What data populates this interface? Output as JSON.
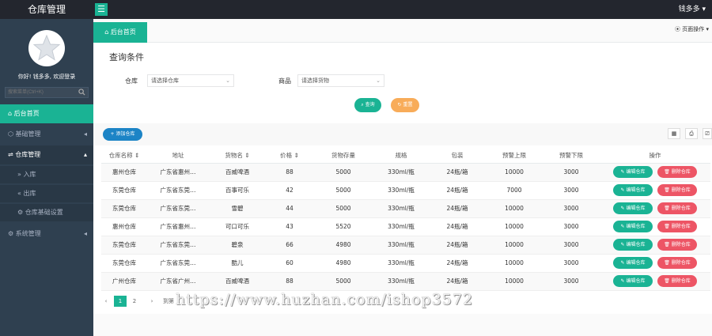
{
  "app": {
    "title": "仓库管理",
    "user": "钱多多 ▾",
    "menu_icon": "hamburger-icon"
  },
  "sidebar": {
    "welcome": "你好! 钱多多, 欢迎登录",
    "search_placeholder": "搜索菜单(Ctrl+K)",
    "items": [
      {
        "label": "后台首页",
        "icon": "home-icon",
        "active": true
      },
      {
        "label": "基础管理",
        "icon": "box-icon",
        "caret": "◂"
      },
      {
        "label": "仓库管理",
        "icon": "warehouse-icon",
        "caret": "▴"
      },
      {
        "label": "入库",
        "icon": "double-chevron-right-icon"
      },
      {
        "label": "出库",
        "icon": "double-chevron-left-icon"
      },
      {
        "label": "仓库基础设置",
        "icon": "gear-icon"
      },
      {
        "label": "系统管理",
        "icon": "gear-icon",
        "caret": "◂"
      }
    ]
  },
  "tabs": {
    "active": "后台首页",
    "page_ops": "⦿ 页面操作 ▾"
  },
  "query": {
    "title": "查询条件",
    "warehouse_label": "仓库",
    "warehouse_value": "请选择仓库",
    "goods_label": "商品",
    "goods_value": "请选择货物",
    "search_btn": "查询",
    "reset_btn": "重置"
  },
  "toolbar": {
    "add_btn": "+ 添加仓库"
  },
  "table": {
    "headers": [
      "仓库名称 ⇕",
      "地址",
      "货物名 ⇕",
      "价格 ⇕",
      "货物存量",
      "规格",
      "包装",
      "预警上限",
      "预警下限",
      "操作"
    ],
    "rows": [
      [
        "惠州仓库",
        "广东省惠州…",
        "百威啤酒",
        "88",
        "5000",
        "330ml/瓶",
        "24瓶/箱",
        "10000",
        "3000"
      ],
      [
        "东莞仓库",
        "广东省东莞…",
        "百事可乐",
        "42",
        "5000",
        "330ml/瓶",
        "24瓶/箱",
        "7000",
        "3000"
      ],
      [
        "东莞仓库",
        "广东省东莞…",
        "雪碧",
        "44",
        "5000",
        "330ml/瓶",
        "24瓶/箱",
        "10000",
        "3000"
      ],
      [
        "惠州仓库",
        "广东省惠州…",
        "可口可乐",
        "43",
        "5520",
        "330ml/瓶",
        "24瓶/箱",
        "10000",
        "3000"
      ],
      [
        "东莞仓库",
        "广东省东莞…",
        "碧泉",
        "66",
        "4980",
        "330ml/瓶",
        "24瓶/箱",
        "10000",
        "3000"
      ],
      [
        "东莞仓库",
        "广东省东莞…",
        "酷儿",
        "60",
        "4980",
        "330ml/瓶",
        "24瓶/箱",
        "10000",
        "3000"
      ],
      [
        "广州仓库",
        "广东省广州…",
        "百威啤酒",
        "88",
        "5000",
        "330ml/瓶",
        "24瓶/箱",
        "10000",
        "3000"
      ]
    ],
    "edit_btn": "✎ 编辑仓库",
    "delete_btn": "🗑 删除仓库"
  },
  "pager": {
    "prev": "‹",
    "pages": [
      "1",
      "2"
    ],
    "next": "›",
    "goto": "到第"
  },
  "watermark": "https://www.huzhan.com/ishop3572",
  "colors": {
    "accent": "#1ab394",
    "sidebar": "#2f4050",
    "topbar": "#23262e",
    "danger": "#ed5565",
    "warning": "#f8ac59",
    "primary": "#1c84c6"
  }
}
